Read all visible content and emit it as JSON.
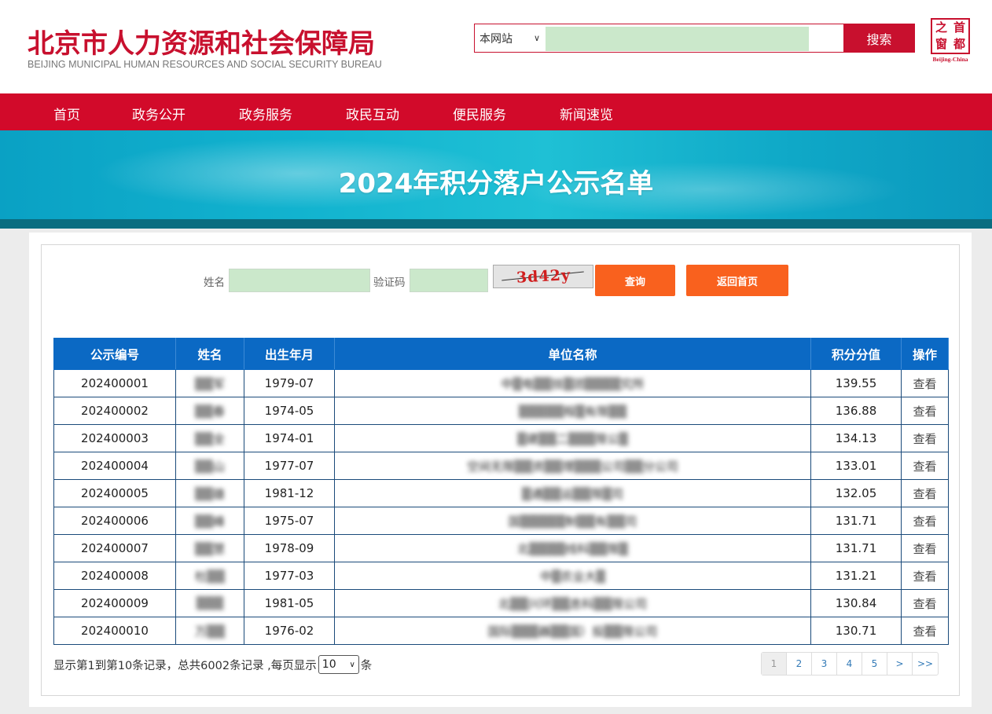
{
  "header": {
    "title_cn": "北京市人力资源和社会保障局",
    "title_en": "BEIJING MUNICIPAL HUMAN RESOURCES AND SOCIAL SECURITY BUREAU",
    "search_scope": "本网站",
    "search_button": "搜索",
    "seal_chars": [
      "之",
      "首",
      "窗",
      "都"
    ],
    "seal_en": "Beijing-China"
  },
  "nav": [
    "首页",
    "政务公开",
    "政务服务",
    "政民互动",
    "便民服务",
    "新闻速览"
  ],
  "banner": {
    "title": "2024年积分落户公示名单"
  },
  "form": {
    "name_label": "姓名",
    "captcha_label": "验证码",
    "captcha_text": "3d42y",
    "query_button": "查询",
    "home_button": "返回首页"
  },
  "table": {
    "headers": [
      "公示编号",
      "姓名",
      "出生年月",
      "单位名称",
      "积分分值",
      "操作"
    ],
    "rows": [
      {
        "id": "202400001",
        "name": "▒▒军",
        "birth": "1979-07",
        "unit": "中▒电▒▒技▒团▒▒▒▒究所",
        "score": "139.55",
        "action": "查看"
      },
      {
        "id": "202400002",
        "name": "▒▒春",
        "birth": "1974-05",
        "unit": "▒▒▒▒▒程▒有限▒▒",
        "score": "136.88",
        "action": "查看"
      },
      {
        "id": "202400003",
        "name": "▒▒全",
        "birth": "1974-01",
        "unit": "▒建▒▒二▒▒▒限公▒",
        "score": "134.13",
        "action": "查看"
      },
      {
        "id": "202400004",
        "name": "▒▒山",
        "birth": "1977-07",
        "unit": "空间无限▒▒资▒▒理▒▒▒公司▒▒分公司",
        "score": "133.01",
        "action": "查看"
      },
      {
        "id": "202400005",
        "name": "▒▒雄",
        "birth": "1981-12",
        "unit": "▒通▒▒运▒▒限▒司",
        "score": "132.05",
        "action": "查看"
      },
      {
        "id": "202400006",
        "name": "▒▒峰",
        "birth": "1975-07",
        "unit": "国▒▒▒▒▒制▒▒有▒▒司",
        "score": "131.71",
        "action": "查看"
      },
      {
        "id": "202400007",
        "name": "▒▒慧",
        "birth": "1978-09",
        "unit": "北▒▒▒▒线科▒▒限▒",
        "score": "131.71",
        "action": "查看"
      },
      {
        "id": "202400008",
        "name": "杜▒▒",
        "birth": "1977-03",
        "unit": "中▒农业大▒",
        "score": "131.21",
        "action": "查看"
      },
      {
        "id": "202400009",
        "name": "▒▒▒",
        "birth": "1981-05",
        "unit": "北▒▒兴环▒▒息科▒▒限公司",
        "score": "130.84",
        "action": "查看"
      },
      {
        "id": "202400010",
        "name": "万▒▒",
        "birth": "1976-02",
        "unit": "国际▒▒▒器▒▒国）投▒▒限公司",
        "score": "130.71",
        "action": "查看"
      }
    ]
  },
  "footer": {
    "records_prefix": "显示第1到第10条记录，总共6002条记录 ,每页显示",
    "page_size": "10",
    "records_suffix": "条",
    "pager": [
      "1",
      "2",
      "3",
      "4",
      "5",
      ">",
      ">>"
    ]
  },
  "colors": {
    "brand_red": "#d20a2a",
    "table_header_blue": "#0b69c4",
    "button_orange": "#f9611e",
    "banner_cyan": "#12b3cf"
  }
}
